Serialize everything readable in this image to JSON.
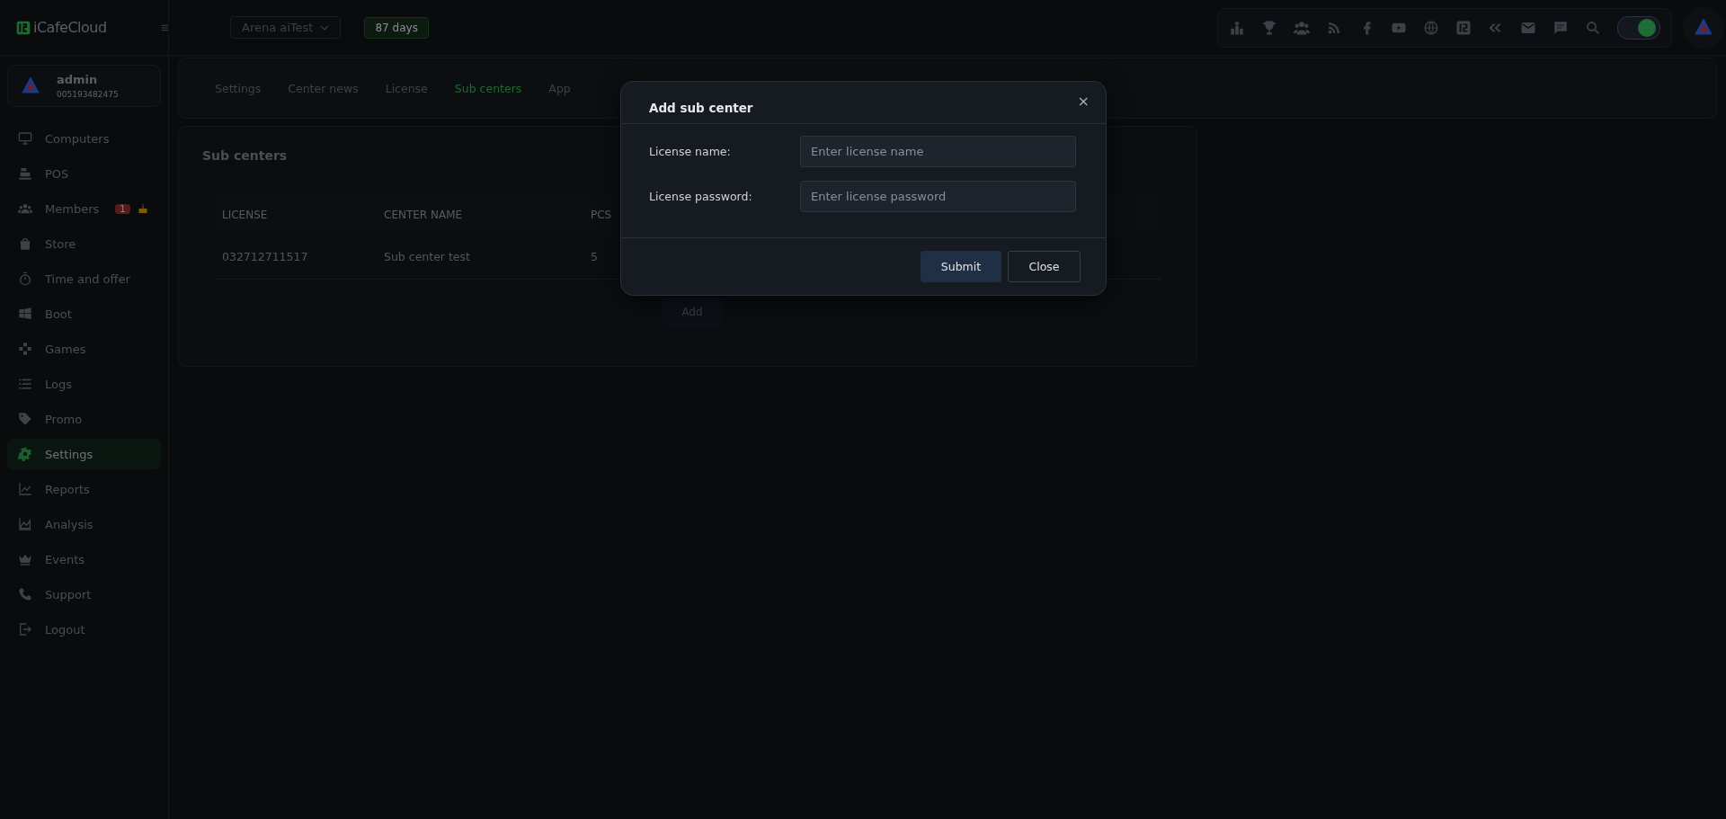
{
  "brand": {
    "name": "iCafeCloud"
  },
  "topbar": {
    "center_select": "Arena aiTest",
    "days_badge": "87 days",
    "toggle": {
      "on": true
    }
  },
  "user": {
    "name": "admin",
    "phone": "005193482475"
  },
  "sidebar": {
    "items": [
      {
        "label": "Computers",
        "selected": false
      },
      {
        "label": "POS",
        "selected": false
      },
      {
        "label": "Members",
        "selected": false,
        "badge": "1"
      },
      {
        "label": "Store",
        "selected": false
      },
      {
        "label": "Time and offer",
        "selected": false
      },
      {
        "label": "Boot",
        "selected": false
      },
      {
        "label": "Games",
        "selected": false
      },
      {
        "label": "Logs",
        "selected": false
      },
      {
        "label": "Promo",
        "selected": false
      },
      {
        "label": "Settings",
        "selected": true
      },
      {
        "label": "Reports",
        "selected": false
      },
      {
        "label": "Analysis",
        "selected": false
      },
      {
        "label": "Events",
        "selected": false
      },
      {
        "label": "Support",
        "selected": false
      },
      {
        "label": "Logout",
        "selected": false
      }
    ]
  },
  "tabs": [
    {
      "label": "Settings",
      "selected": false
    },
    {
      "label": "Center news",
      "selected": false
    },
    {
      "label": "License",
      "selected": false
    },
    {
      "label": "Sub centers",
      "selected": true
    },
    {
      "label": "App",
      "selected": false
    }
  ],
  "sub_centers": {
    "title": "Sub centers",
    "table": {
      "columns": [
        "LICENSE",
        "CENTER NAME",
        "PCS"
      ],
      "rows": [
        [
          "032712711517",
          "Sub center test",
          "5"
        ]
      ]
    },
    "add_button": "Add"
  },
  "modal": {
    "title": "Add sub center",
    "close": "×",
    "fields": [
      {
        "label": "License name:",
        "placeholder": "Enter license name"
      },
      {
        "label": "License password:",
        "placeholder": "Enter license password"
      }
    ],
    "buttons": [
      {
        "label": "Submit",
        "kind": "primary"
      },
      {
        "label": "Close",
        "kind": "secondary"
      }
    ]
  }
}
